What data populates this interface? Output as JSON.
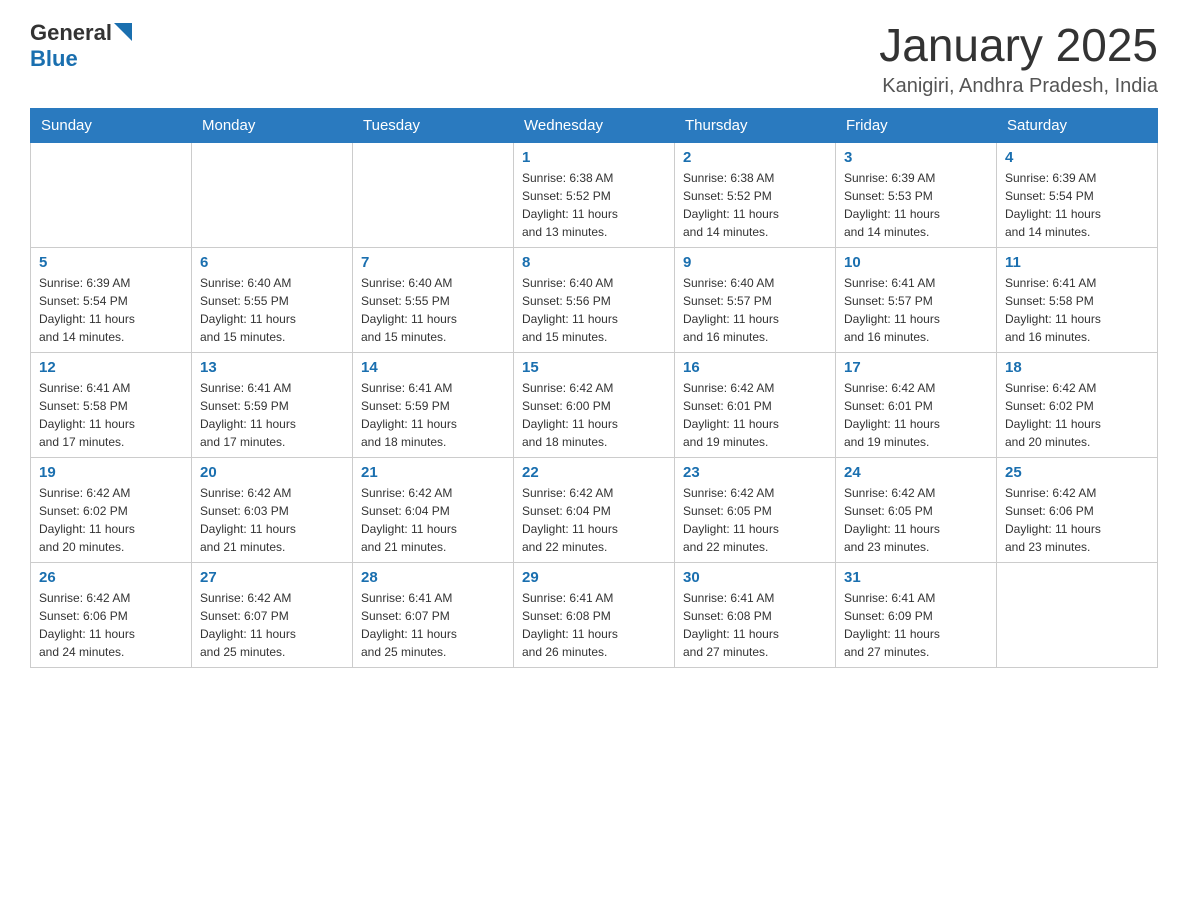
{
  "header": {
    "logo_general": "General",
    "logo_blue": "Blue",
    "month": "January 2025",
    "location": "Kanigiri, Andhra Pradesh, India"
  },
  "days_of_week": [
    "Sunday",
    "Monday",
    "Tuesday",
    "Wednesday",
    "Thursday",
    "Friday",
    "Saturday"
  ],
  "weeks": [
    [
      {
        "day": "",
        "info": ""
      },
      {
        "day": "",
        "info": ""
      },
      {
        "day": "",
        "info": ""
      },
      {
        "day": "1",
        "info": "Sunrise: 6:38 AM\nSunset: 5:52 PM\nDaylight: 11 hours\nand 13 minutes."
      },
      {
        "day": "2",
        "info": "Sunrise: 6:38 AM\nSunset: 5:52 PM\nDaylight: 11 hours\nand 14 minutes."
      },
      {
        "day": "3",
        "info": "Sunrise: 6:39 AM\nSunset: 5:53 PM\nDaylight: 11 hours\nand 14 minutes."
      },
      {
        "day": "4",
        "info": "Sunrise: 6:39 AM\nSunset: 5:54 PM\nDaylight: 11 hours\nand 14 minutes."
      }
    ],
    [
      {
        "day": "5",
        "info": "Sunrise: 6:39 AM\nSunset: 5:54 PM\nDaylight: 11 hours\nand 14 minutes."
      },
      {
        "day": "6",
        "info": "Sunrise: 6:40 AM\nSunset: 5:55 PM\nDaylight: 11 hours\nand 15 minutes."
      },
      {
        "day": "7",
        "info": "Sunrise: 6:40 AM\nSunset: 5:55 PM\nDaylight: 11 hours\nand 15 minutes."
      },
      {
        "day": "8",
        "info": "Sunrise: 6:40 AM\nSunset: 5:56 PM\nDaylight: 11 hours\nand 15 minutes."
      },
      {
        "day": "9",
        "info": "Sunrise: 6:40 AM\nSunset: 5:57 PM\nDaylight: 11 hours\nand 16 minutes."
      },
      {
        "day": "10",
        "info": "Sunrise: 6:41 AM\nSunset: 5:57 PM\nDaylight: 11 hours\nand 16 minutes."
      },
      {
        "day": "11",
        "info": "Sunrise: 6:41 AM\nSunset: 5:58 PM\nDaylight: 11 hours\nand 16 minutes."
      }
    ],
    [
      {
        "day": "12",
        "info": "Sunrise: 6:41 AM\nSunset: 5:58 PM\nDaylight: 11 hours\nand 17 minutes."
      },
      {
        "day": "13",
        "info": "Sunrise: 6:41 AM\nSunset: 5:59 PM\nDaylight: 11 hours\nand 17 minutes."
      },
      {
        "day": "14",
        "info": "Sunrise: 6:41 AM\nSunset: 5:59 PM\nDaylight: 11 hours\nand 18 minutes."
      },
      {
        "day": "15",
        "info": "Sunrise: 6:42 AM\nSunset: 6:00 PM\nDaylight: 11 hours\nand 18 minutes."
      },
      {
        "day": "16",
        "info": "Sunrise: 6:42 AM\nSunset: 6:01 PM\nDaylight: 11 hours\nand 19 minutes."
      },
      {
        "day": "17",
        "info": "Sunrise: 6:42 AM\nSunset: 6:01 PM\nDaylight: 11 hours\nand 19 minutes."
      },
      {
        "day": "18",
        "info": "Sunrise: 6:42 AM\nSunset: 6:02 PM\nDaylight: 11 hours\nand 20 minutes."
      }
    ],
    [
      {
        "day": "19",
        "info": "Sunrise: 6:42 AM\nSunset: 6:02 PM\nDaylight: 11 hours\nand 20 minutes."
      },
      {
        "day": "20",
        "info": "Sunrise: 6:42 AM\nSunset: 6:03 PM\nDaylight: 11 hours\nand 21 minutes."
      },
      {
        "day": "21",
        "info": "Sunrise: 6:42 AM\nSunset: 6:04 PM\nDaylight: 11 hours\nand 21 minutes."
      },
      {
        "day": "22",
        "info": "Sunrise: 6:42 AM\nSunset: 6:04 PM\nDaylight: 11 hours\nand 22 minutes."
      },
      {
        "day": "23",
        "info": "Sunrise: 6:42 AM\nSunset: 6:05 PM\nDaylight: 11 hours\nand 22 minutes."
      },
      {
        "day": "24",
        "info": "Sunrise: 6:42 AM\nSunset: 6:05 PM\nDaylight: 11 hours\nand 23 minutes."
      },
      {
        "day": "25",
        "info": "Sunrise: 6:42 AM\nSunset: 6:06 PM\nDaylight: 11 hours\nand 23 minutes."
      }
    ],
    [
      {
        "day": "26",
        "info": "Sunrise: 6:42 AM\nSunset: 6:06 PM\nDaylight: 11 hours\nand 24 minutes."
      },
      {
        "day": "27",
        "info": "Sunrise: 6:42 AM\nSunset: 6:07 PM\nDaylight: 11 hours\nand 25 minutes."
      },
      {
        "day": "28",
        "info": "Sunrise: 6:41 AM\nSunset: 6:07 PM\nDaylight: 11 hours\nand 25 minutes."
      },
      {
        "day": "29",
        "info": "Sunrise: 6:41 AM\nSunset: 6:08 PM\nDaylight: 11 hours\nand 26 minutes."
      },
      {
        "day": "30",
        "info": "Sunrise: 6:41 AM\nSunset: 6:08 PM\nDaylight: 11 hours\nand 27 minutes."
      },
      {
        "day": "31",
        "info": "Sunrise: 6:41 AM\nSunset: 6:09 PM\nDaylight: 11 hours\nand 27 minutes."
      },
      {
        "day": "",
        "info": ""
      }
    ]
  ]
}
